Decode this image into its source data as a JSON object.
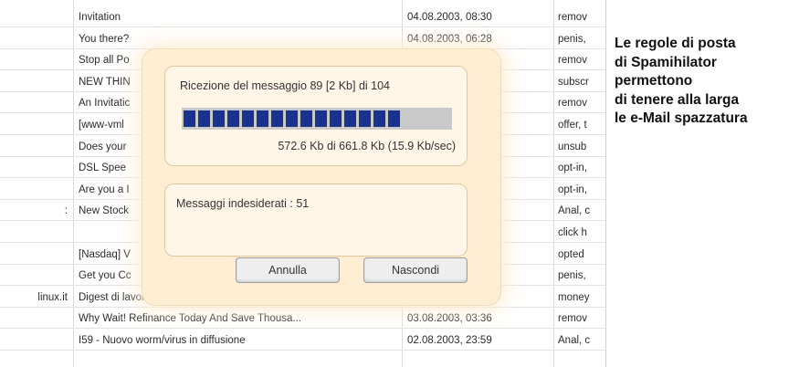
{
  "mail_list": {
    "rows": [
      {
        "sender": "",
        "subject": "Invitation",
        "date": "04.08.2003, 08:30",
        "rule": "remov"
      },
      {
        "sender": "",
        "subject": "You there?",
        "date": "04.08.2003, 06:28",
        "rule": "penis,"
      },
      {
        "sender": "",
        "subject": "Stop all Po",
        "date": "3, 23:54",
        "rule": "remov"
      },
      {
        "sender": "",
        "subject": "NEW THIN",
        "date": "3, 23:49",
        "rule": "subscr"
      },
      {
        "sender": "",
        "subject": "An Invitatic",
        "date": "3, 23:13",
        "rule": "remov"
      },
      {
        "sender": "",
        "subject": "[www-vml",
        "date": "3, 22:54",
        "rule": "offer, t"
      },
      {
        "sender": "",
        "subject": "Does your",
        "date": "3, 21:17",
        "rule": "unsub"
      },
      {
        "sender": "",
        "subject": "DSL Spee",
        "date": "3, 21:17",
        "rule": "opt-in,"
      },
      {
        "sender": "",
        "subject": "Are you a I",
        "date": "3, 21:11",
        "rule": "opt-in,"
      },
      {
        "sender": ":",
        "subject": "New Stock",
        "date": "3, 21:09",
        "rule": "Anal, c"
      },
      {
        "sender": "",
        "subject": "",
        "date": "3, 20:59",
        "rule": "click h"
      },
      {
        "sender": "",
        "subject": "[Nasdaq] V",
        "date": "3, 18:02",
        "rule": "opted"
      },
      {
        "sender": "",
        "subject": "Get you Cc",
        "date": "3, 17:40",
        "rule": "penis,"
      },
      {
        "sender": "linux.it",
        "subject": "Digest di lavoro, Volume 3, Numero 2",
        "date": "03.08.2003, 10:00",
        "rule": "money"
      },
      {
        "sender": "",
        "subject": "Why Wait! Refinance Today And Save Thousa...",
        "date": "03.08.2003, 03:36",
        "rule": "remov"
      },
      {
        "sender": "",
        "subject": "I59 - Nuovo worm/virus in diffusione",
        "date": "02.08.2003, 23:59",
        "rule": "Anal, c"
      }
    ]
  },
  "dialog": {
    "receiving_text": "Ricezione del messaggio 89 [2 Kb] di 104",
    "progress": 0.86,
    "segments_total": 18,
    "transfer_text": "572.6 Kb di 661.8 Kb (15.9 Kb/sec)",
    "unwanted_text": "Messaggi indesiderati : 51",
    "cancel_label": "Annulla",
    "hide_label": "Nascondi"
  },
  "caption": {
    "lines": [
      "Le regole di posta",
      "di Spamihilator",
      "permettono",
      "di tenere alla larga",
      "le e-Mail spazzatura"
    ]
  },
  "colors": {
    "progress_fill": "#17338f",
    "dialog_bg": "#ffeed3"
  }
}
